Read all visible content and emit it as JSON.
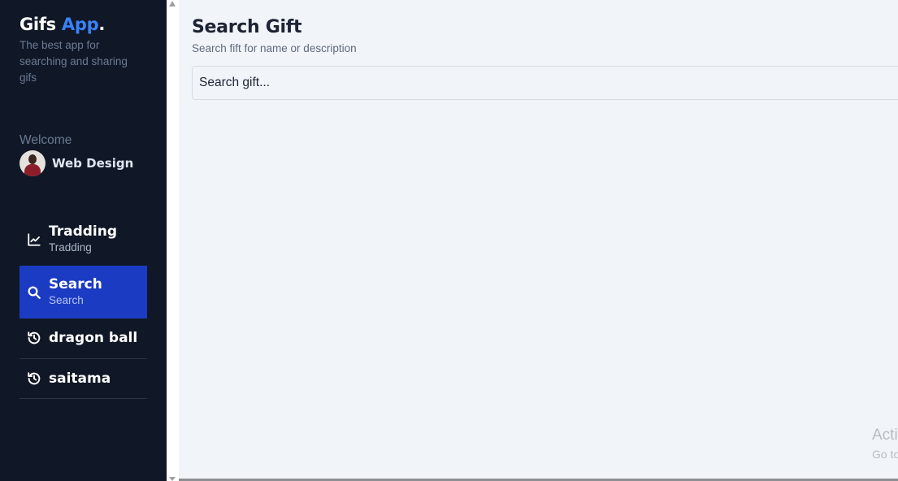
{
  "brand": {
    "name": "Gifs",
    "accent": "App",
    "dot": "."
  },
  "tagline": "The best app for searching and sharing gifs",
  "welcome": {
    "label": "Welcome",
    "username": "Web Design"
  },
  "nav": [
    {
      "label": "Tradding",
      "sub": "Tradding",
      "icon": "trending-chart-icon",
      "active": false
    },
    {
      "label": "Search",
      "sub": "Search",
      "icon": "search-icon",
      "active": true
    },
    {
      "label": "dragon ball",
      "icon": "history-icon"
    },
    {
      "label": "saitama",
      "icon": "history-icon"
    }
  ],
  "main": {
    "title": "Search Gift",
    "subtitle": "Search fift for name or description",
    "search_placeholder": "Search gift..."
  },
  "overlay": {
    "line1": "Acti",
    "line2": "Go to"
  },
  "colors": {
    "sidebar_bg": "#101827",
    "active_bg": "#1b3bc2",
    "accent": "#3b82f6",
    "main_bg": "#f1f4f9"
  }
}
